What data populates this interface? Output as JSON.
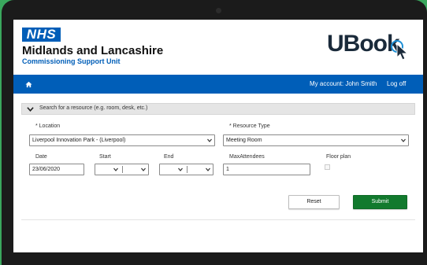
{
  "header": {
    "nhs_logo": "NHS",
    "org_name": "Midlands and Lancashire",
    "org_unit": "Commissioning Support Unit",
    "app_logo": "UBook",
    "icons": [
      "home-icon",
      "chevron-down-icon",
      "cursor-icon",
      "checkbox"
    ]
  },
  "colors": {
    "nhs_blue": "#005eb8",
    "submit_green": "#127a2e",
    "background_green": "#3aa75d"
  },
  "navbar": {
    "account_label": "My account:  John Smith",
    "logoff_label": "Log off"
  },
  "search_panel": {
    "title": "Search for a resource (e.g. room, desk, etc.)"
  },
  "form": {
    "location_label": "* Location",
    "location_value": "Liverpool Innovation Park - (Liverpool)",
    "resource_type_label": "* Resource Type",
    "resource_type_value": "Meeting Room",
    "date_label": "Date",
    "date_value": "23/06/2020",
    "start_label": "Start",
    "end_label": "End",
    "max_attendees_label": "MaxAttendees",
    "max_attendees_value": "1",
    "floor_plan_label": "Floor plan",
    "floor_plan_checked": false
  },
  "actions": {
    "reset_label": "Reset",
    "submit_label": "Submit"
  }
}
